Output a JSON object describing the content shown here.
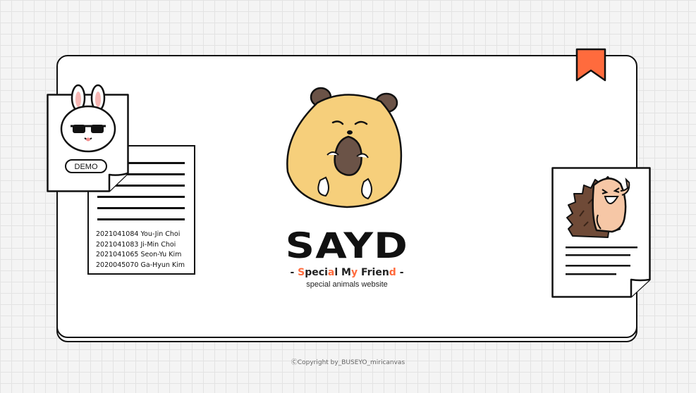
{
  "logo": {
    "title": "SAYD",
    "tagline_prefix": "- ",
    "tagline_suffix": " -",
    "tagline_segments": [
      {
        "text": "S",
        "highlight": true
      },
      {
        "text": "peci",
        "highlight": false
      },
      {
        "text": "a",
        "highlight": true
      },
      {
        "text": "l M",
        "highlight": false
      },
      {
        "text": "y",
        "highlight": true
      },
      {
        "text": " Frien",
        "highlight": false
      },
      {
        "text": "d",
        "highlight": true
      }
    ],
    "subtitle": "special animals website"
  },
  "demo_note": {
    "button_label": "DEMO",
    "character_icon": "bunny-with-sunglasses-icon"
  },
  "members": [
    "2021041084 You-Jin Choi",
    "2021041083 Ji-Min Choi",
    "2021041065 Seon-Yu Kim",
    "2020045070 Ga-Hyun Kim"
  ],
  "right_note": {
    "character_icon": "hedgehog-icon"
  },
  "hero_icon": "hamster-holding-seed-icon",
  "bookmark_icon": "bookmark-icon",
  "copyright": "ⒸCopyright by_BUSEYO_miricanvas",
  "colors": {
    "accent": "#ff6b3d",
    "hamster": "#f6cf7b",
    "outline": "#111111",
    "background": "#f4f4f4"
  }
}
